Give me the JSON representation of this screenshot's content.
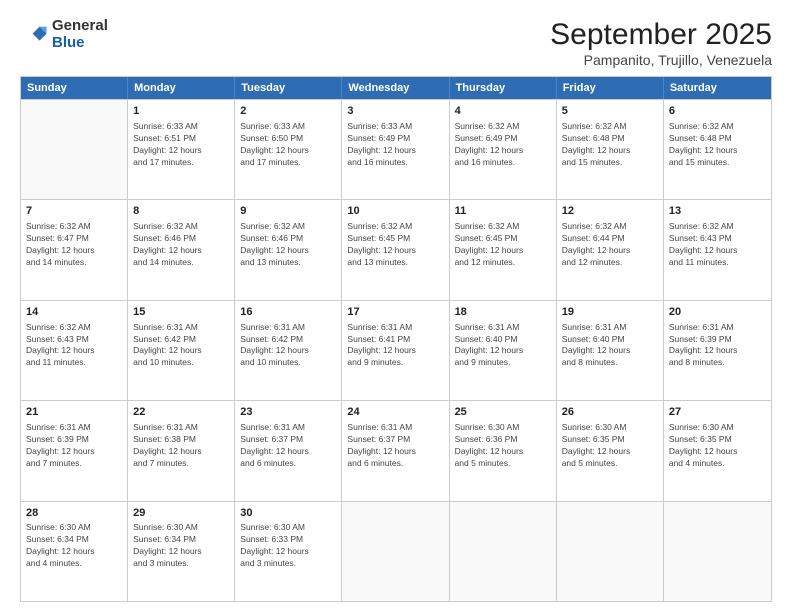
{
  "logo": {
    "general": "General",
    "blue": "Blue"
  },
  "title": "September 2025",
  "subtitle": "Pampanito, Trujillo, Venezuela",
  "days": [
    "Sunday",
    "Monday",
    "Tuesday",
    "Wednesday",
    "Thursday",
    "Friday",
    "Saturday"
  ],
  "weeks": [
    [
      {
        "day": "",
        "empty": true
      },
      {
        "day": "1",
        "sunrise": "6:33 AM",
        "sunset": "6:51 PM",
        "daylight": "12 hours and 17 minutes."
      },
      {
        "day": "2",
        "sunrise": "6:33 AM",
        "sunset": "6:50 PM",
        "daylight": "12 hours and 17 minutes."
      },
      {
        "day": "3",
        "sunrise": "6:33 AM",
        "sunset": "6:49 PM",
        "daylight": "12 hours and 16 minutes."
      },
      {
        "day": "4",
        "sunrise": "6:32 AM",
        "sunset": "6:49 PM",
        "daylight": "12 hours and 16 minutes."
      },
      {
        "day": "5",
        "sunrise": "6:32 AM",
        "sunset": "6:48 PM",
        "daylight": "12 hours and 15 minutes."
      },
      {
        "day": "6",
        "sunrise": "6:32 AM",
        "sunset": "6:48 PM",
        "daylight": "12 hours and 15 minutes."
      }
    ],
    [
      {
        "day": "7",
        "sunrise": "6:32 AM",
        "sunset": "6:47 PM",
        "daylight": "12 hours and 14 minutes."
      },
      {
        "day": "8",
        "sunrise": "6:32 AM",
        "sunset": "6:46 PM",
        "daylight": "12 hours and 14 minutes."
      },
      {
        "day": "9",
        "sunrise": "6:32 AM",
        "sunset": "6:46 PM",
        "daylight": "12 hours and 13 minutes."
      },
      {
        "day": "10",
        "sunrise": "6:32 AM",
        "sunset": "6:45 PM",
        "daylight": "12 hours and 13 minutes."
      },
      {
        "day": "11",
        "sunrise": "6:32 AM",
        "sunset": "6:45 PM",
        "daylight": "12 hours and 12 minutes."
      },
      {
        "day": "12",
        "sunrise": "6:32 AM",
        "sunset": "6:44 PM",
        "daylight": "12 hours and 12 minutes."
      },
      {
        "day": "13",
        "sunrise": "6:32 AM",
        "sunset": "6:43 PM",
        "daylight": "12 hours and 11 minutes."
      }
    ],
    [
      {
        "day": "14",
        "sunrise": "6:32 AM",
        "sunset": "6:43 PM",
        "daylight": "12 hours and 11 minutes."
      },
      {
        "day": "15",
        "sunrise": "6:31 AM",
        "sunset": "6:42 PM",
        "daylight": "12 hours and 10 minutes."
      },
      {
        "day": "16",
        "sunrise": "6:31 AM",
        "sunset": "6:42 PM",
        "daylight": "12 hours and 10 minutes."
      },
      {
        "day": "17",
        "sunrise": "6:31 AM",
        "sunset": "6:41 PM",
        "daylight": "12 hours and 9 minutes."
      },
      {
        "day": "18",
        "sunrise": "6:31 AM",
        "sunset": "6:40 PM",
        "daylight": "12 hours and 9 minutes."
      },
      {
        "day": "19",
        "sunrise": "6:31 AM",
        "sunset": "6:40 PM",
        "daylight": "12 hours and 8 minutes."
      },
      {
        "day": "20",
        "sunrise": "6:31 AM",
        "sunset": "6:39 PM",
        "daylight": "12 hours and 8 minutes."
      }
    ],
    [
      {
        "day": "21",
        "sunrise": "6:31 AM",
        "sunset": "6:39 PM",
        "daylight": "12 hours and 7 minutes."
      },
      {
        "day": "22",
        "sunrise": "6:31 AM",
        "sunset": "6:38 PM",
        "daylight": "12 hours and 7 minutes."
      },
      {
        "day": "23",
        "sunrise": "6:31 AM",
        "sunset": "6:37 PM",
        "daylight": "12 hours and 6 minutes."
      },
      {
        "day": "24",
        "sunrise": "6:31 AM",
        "sunset": "6:37 PM",
        "daylight": "12 hours and 6 minutes."
      },
      {
        "day": "25",
        "sunrise": "6:30 AM",
        "sunset": "6:36 PM",
        "daylight": "12 hours and 5 minutes."
      },
      {
        "day": "26",
        "sunrise": "6:30 AM",
        "sunset": "6:35 PM",
        "daylight": "12 hours and 5 minutes."
      },
      {
        "day": "27",
        "sunrise": "6:30 AM",
        "sunset": "6:35 PM",
        "daylight": "12 hours and 4 minutes."
      }
    ],
    [
      {
        "day": "28",
        "sunrise": "6:30 AM",
        "sunset": "6:34 PM",
        "daylight": "12 hours and 4 minutes."
      },
      {
        "day": "29",
        "sunrise": "6:30 AM",
        "sunset": "6:34 PM",
        "daylight": "12 hours and 3 minutes."
      },
      {
        "day": "30",
        "sunrise": "6:30 AM",
        "sunset": "6:33 PM",
        "daylight": "12 hours and 3 minutes."
      },
      {
        "day": "",
        "empty": true
      },
      {
        "day": "",
        "empty": true
      },
      {
        "day": "",
        "empty": true
      },
      {
        "day": "",
        "empty": true
      }
    ]
  ]
}
